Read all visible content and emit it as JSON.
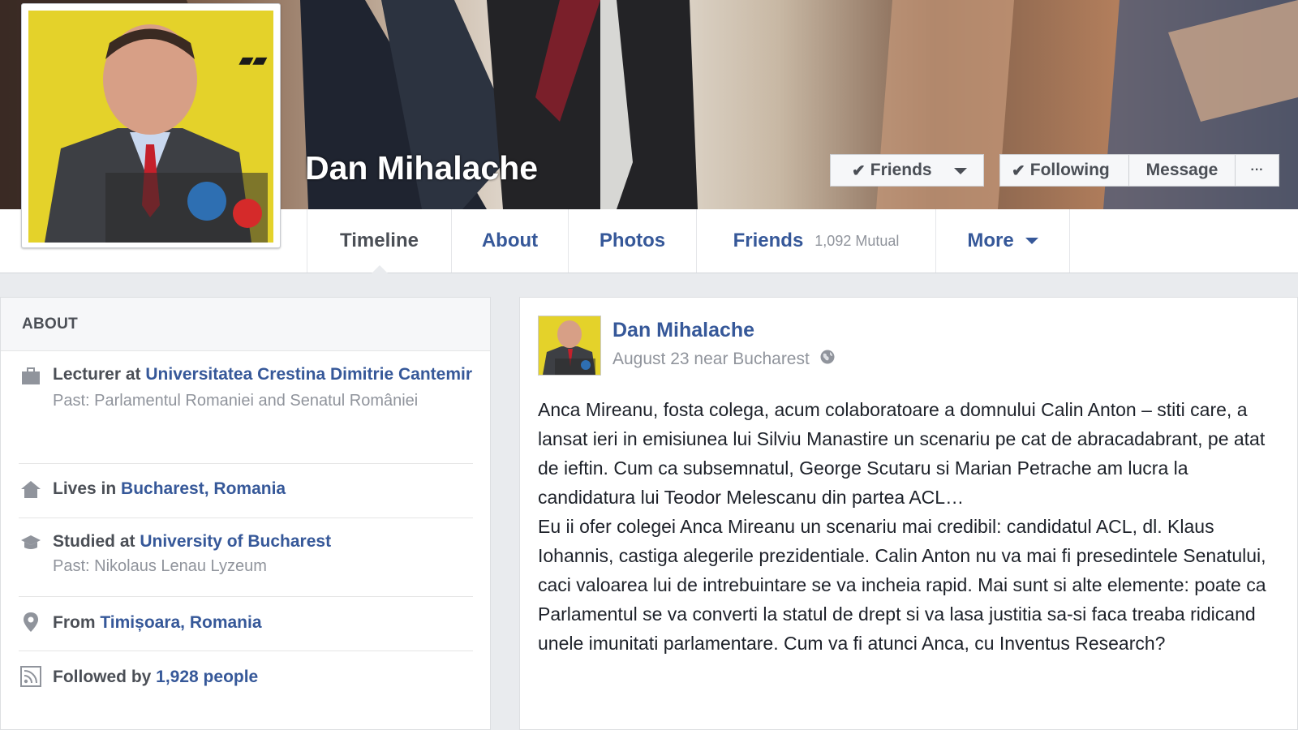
{
  "profile": {
    "name": "Dan Mihalache"
  },
  "actions": {
    "friends_label": "Friends",
    "following_label": "Following",
    "message_label": "Message",
    "more_label": "···"
  },
  "tabs": [
    {
      "label": "Timeline"
    },
    {
      "label": "About"
    },
    {
      "label": "Photos"
    },
    {
      "label": "Friends",
      "count": "1,092 Mutual"
    },
    {
      "label": "More"
    }
  ],
  "about": {
    "heading": "ABOUT",
    "work": {
      "prefix": "Lecturer at ",
      "link": "Universitatea Crestina Dimitrie Cantemir",
      "past": "Past: Parlamentul Romaniei and Senatul României",
      "icon": "briefcase-icon"
    },
    "lives": {
      "prefix": "Lives in ",
      "link": "Bucharest, Romania",
      "icon": "home-icon"
    },
    "studied": {
      "prefix": "Studied at ",
      "link": "University of Bucharest",
      "past": "Past: Nikolaus Lenau Lyzeum",
      "icon": "graduation-cap-icon"
    },
    "from": {
      "prefix": "From ",
      "link": "Timișoara, Romania",
      "icon": "map-pin-icon"
    },
    "followed": {
      "prefix": "Followed by ",
      "link": "1,928 people",
      "icon": "rss-icon"
    }
  },
  "post": {
    "author": "Dan Mihalache",
    "meta": "August 23 near Bucharest",
    "privacy_icon": "globe-icon",
    "paragraphs": [
      "Anca Mireanu, fosta colega, acum colaboratoare a domnului Calin Anton – stiti care, a lansat ieri in emisiunea lui Silviu Manastire un scenariu pe cat de abracadabrant, pe atat de ieftin. Cum ca subsemnatul, George Scutaru si Marian Petrache am lucra la candidatura lui Teodor Melescanu din partea ACL…",
      "Eu ii ofer colegei Anca Mireanu un scenariu mai credibil: candidatul ACL, dl. Klaus Iohannis, castiga alegerile prezidentiale. Calin Anton nu va mai fi presedintele Senatului, caci valoarea lui de intrebuintare se va incheia rapid. Mai sunt si alte elemente: poate ca Parlamentul se va converti la statul de drept si va lasa justitia sa-si faca treaba ridicand unele imunitati parlamentare. Cum va fi atunci Anca, cu Inventus Research?"
    ]
  },
  "colors": {
    "link": "#365899",
    "text": "#4b4f56",
    "muted": "#90949c",
    "background": "#e9ebee"
  }
}
